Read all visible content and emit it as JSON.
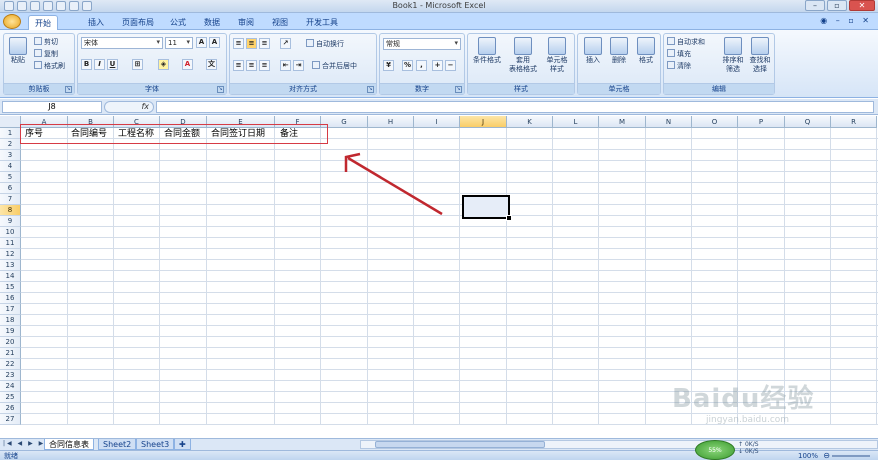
{
  "window": {
    "title": "Book1 - Microsoft Excel",
    "buttons": [
      "–",
      "▫",
      "✕"
    ]
  },
  "ribbon_tabs": [
    "开始",
    "插入",
    "页面布局",
    "公式",
    "数据",
    "审阅",
    "视图",
    "开发工具"
  ],
  "active_tab": "开始",
  "clipboard": {
    "paste_label": "粘贴",
    "cut_label": "剪切",
    "copy_label": "复制",
    "format_painter_label": "格式刷",
    "group_label": "剪贴板"
  },
  "font": {
    "font_name": "宋体",
    "font_size": "11",
    "group_label": "字体",
    "bold": "B",
    "italic": "I",
    "underline": "U"
  },
  "alignment": {
    "wrap_text_label": "自动换行",
    "merge_center_label": "合并后居中",
    "group_label": "对齐方式"
  },
  "number": {
    "format_value": "常规",
    "group_label": "数字"
  },
  "styles": {
    "conditional_format_label": "条件格式",
    "table_format_label_1": "套用",
    "table_format_label_2": "表格格式",
    "cell_styles_label_1": "单元格",
    "cell_styles_label_2": "样式",
    "group_label": "样式"
  },
  "cells_group": {
    "insert_label": "插入",
    "delete_label": "删除",
    "format_label": "格式",
    "group_label": "单元格"
  },
  "editing": {
    "autosum_label": "自动求和",
    "fill_label": "填充",
    "clear_label": "清除",
    "sort_filter_label_1": "排序和",
    "sort_filter_label_2": "筛选",
    "find_select_label_1": "查找和",
    "find_select_label_2": "选择",
    "group_label": "编辑"
  },
  "formula_bar": {
    "name_box": "J8",
    "fx_label": "fx",
    "formula": ""
  },
  "columns": [
    "A",
    "B",
    "C",
    "D",
    "E",
    "F",
    "G",
    "H",
    "I",
    "J",
    "K",
    "L",
    "M",
    "N",
    "O",
    "P",
    "Q",
    "R"
  ],
  "selected_column": "J",
  "rows": [
    "1",
    "2",
    "3",
    "4",
    "5",
    "6",
    "7",
    "8",
    "9",
    "10",
    "11",
    "12",
    "13",
    "14",
    "15",
    "16",
    "17",
    "18",
    "19",
    "20",
    "21",
    "22",
    "23",
    "24",
    "25",
    "26",
    "27"
  ],
  "selected_row": "8",
  "row1_cells": {
    "A1": "序号",
    "B1": "合同编号",
    "C1": "工程名称",
    "D1": "合同金额",
    "E1": "合同签订日期",
    "F1": "备注"
  },
  "sheet_tabs": [
    "合同信息表",
    "Sheet2",
    "Sheet3"
  ],
  "active_sheet": "合同信息表",
  "status": {
    "ready": "就绪",
    "zoom": "100%",
    "net_percent": "55%",
    "net_up": "0K/S",
    "net_down": "0K/S"
  },
  "watermark": {
    "brand": "Baidu经验",
    "url": "jingyan.baidu.com"
  },
  "colors": {
    "highlight_box": "#d63b45",
    "arrow": "#c0282f",
    "ribbon_bg": "#d6e5f7"
  }
}
